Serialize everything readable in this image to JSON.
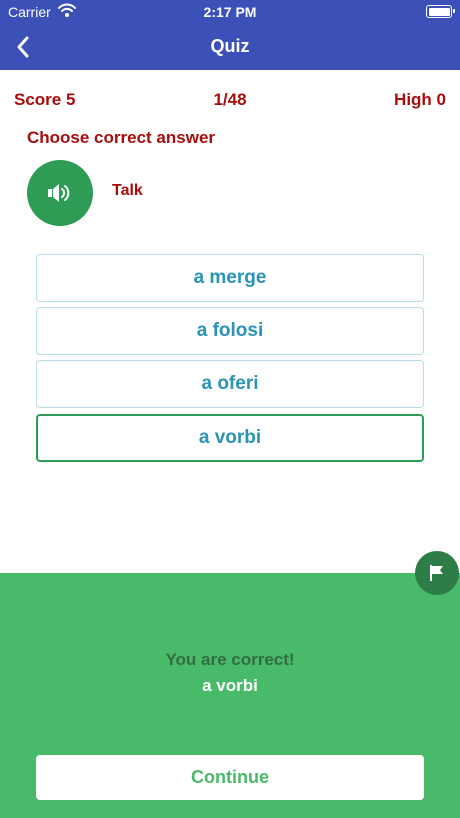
{
  "status_bar": {
    "carrier": "Carrier",
    "time": "2:17 PM"
  },
  "nav": {
    "title": "Quiz"
  },
  "quiz": {
    "score_label": "Score  5",
    "progress": "1/48",
    "high_label": "High  0",
    "instruction": "Choose correct answer",
    "word": "Talk",
    "answers": [
      "a merge",
      "a folosi",
      "a oferi",
      "a vorbi"
    ]
  },
  "result": {
    "message": "You are correct!",
    "answer": "a vorbi",
    "continue_label": "Continue"
  },
  "colors": {
    "header": "#3b51b8",
    "accent_red": "#a80d0d",
    "answer_blue": "#2a93b8",
    "correct_green": "#2e9c55",
    "panel_green": "#49b96a"
  },
  "icons": [
    "wifi-icon",
    "battery-icon",
    "back-chevron-icon",
    "speaker-icon",
    "flag-icon"
  ]
}
